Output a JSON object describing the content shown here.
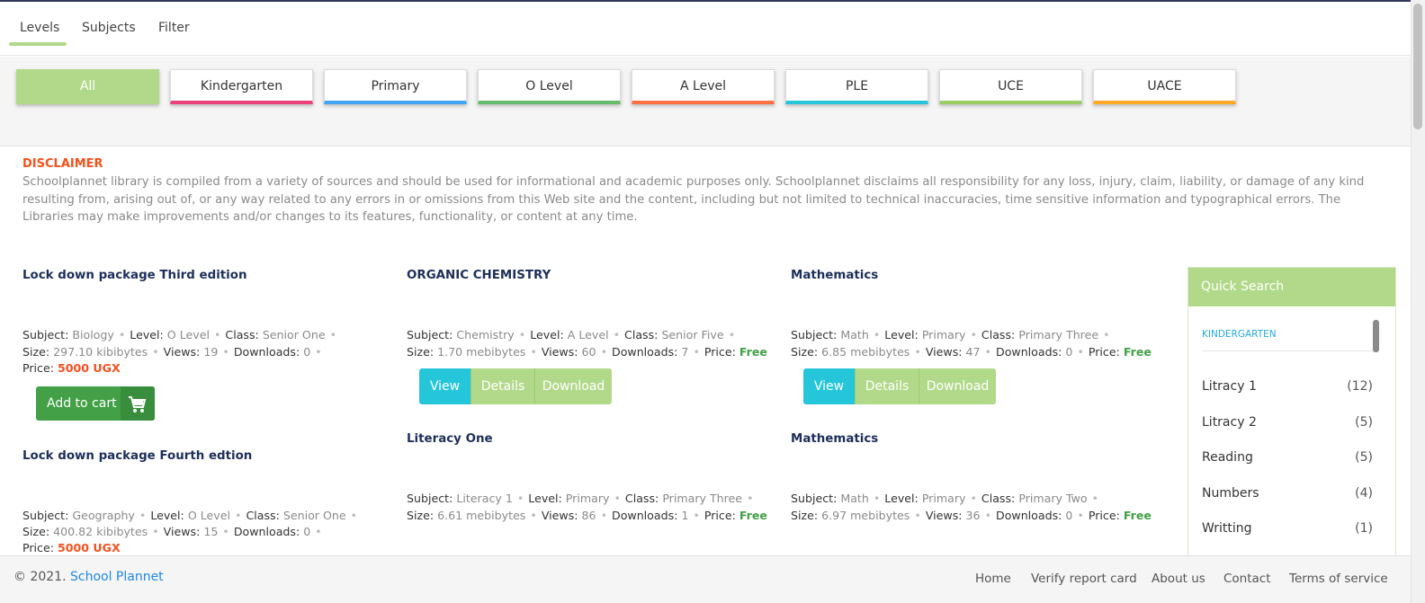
{
  "tabs": [
    "Levels",
    "Subjects",
    "Filter"
  ],
  "levels": [
    {
      "label": "All",
      "color": "#b2d98a"
    },
    {
      "label": "Kindergarten",
      "color": "#ec407a"
    },
    {
      "label": "Primary",
      "color": "#42a5f5"
    },
    {
      "label": "O Level",
      "color": "#66bb6a"
    },
    {
      "label": "A Level",
      "color": "#ff7043"
    },
    {
      "label": "PLE",
      "color": "#26c6da"
    },
    {
      "label": "UCE",
      "color": "#9ccc65"
    },
    {
      "label": "UACE",
      "color": "#ffa726"
    }
  ],
  "disclaimer": {
    "title": "DISCLAIMER",
    "text": "Schoolplannet library is compiled from a variety of sources and should be used for informational and academic purposes only. Schoolplannet disclaims all responsibility for any loss, injury, claim, liability, or damage of any kind resulting from, arising out of, or any way related to any errors in or omissions from this Web site and the content, including but not limited to technical inaccuracies, time sensitive information and typographical errors. The Libraries may make improvements and/or changes to its features, functionality, or content at any time."
  },
  "labels": {
    "subject": "Subject:",
    "level": "Level:",
    "class": "Class:",
    "size": "Size:",
    "views": "Views:",
    "downloads": "Downloads:",
    "price": "Price:",
    "view_btn": "View",
    "details_btn": "Details",
    "download_btn": "Download",
    "add_to_cart": "Add to cart"
  },
  "items": [
    {
      "title": "Lock down package Third edition",
      "subject": "Biology",
      "level": "O Level",
      "class": "Senior One",
      "size": "297.10 kibibytes",
      "views": "19",
      "downloads": "0",
      "price": "5000 UGX"
    },
    {
      "title": "ORGANIC CHEMISTRY",
      "subject": "Chemistry",
      "level": "A Level",
      "class": "Senior Five",
      "size": "1.70 mebibytes",
      "views": "60",
      "downloads": "7",
      "price": "Free"
    },
    {
      "title": "Mathematics",
      "subject": "Math",
      "level": "Primary",
      "class": "Primary Three",
      "size": "6.85 mebibytes",
      "views": "47",
      "downloads": "0",
      "price": "Free"
    },
    {
      "title": "Lock down package Fourth edtion",
      "subject": "Geography",
      "level": "O Level",
      "class": "Senior One",
      "size": "400.82 kibibytes",
      "views": "15",
      "downloads": "0",
      "price": "5000 UGX"
    },
    {
      "title": "Literacy One",
      "subject": "Literacy 1",
      "level": "Primary",
      "class": "Primary Three",
      "size": "6.61 mebibytes",
      "views": "86",
      "downloads": "1",
      "price": "Free"
    },
    {
      "title": "Mathematics",
      "subject": "Math",
      "level": "Primary",
      "class": "Primary Two",
      "size": "6.97 mebibytes",
      "views": "36",
      "downloads": "0",
      "price": "Free"
    }
  ],
  "quick_search": {
    "title": "Quick Search",
    "category": "KINDERGARTEN",
    "items": [
      {
        "label": "Litracy 1",
        "count": "(12)"
      },
      {
        "label": "Litracy 2",
        "count": "(5)"
      },
      {
        "label": "Reading",
        "count": "(5)"
      },
      {
        "label": "Numbers",
        "count": "(4)"
      },
      {
        "label": "Writting",
        "count": "(1)"
      }
    ]
  },
  "footer": {
    "copyright": "© 2021.",
    "brand": "School Plannet",
    "links": [
      "Home",
      "Verify report card",
      "About us",
      "Contact",
      "Terms of service"
    ]
  }
}
